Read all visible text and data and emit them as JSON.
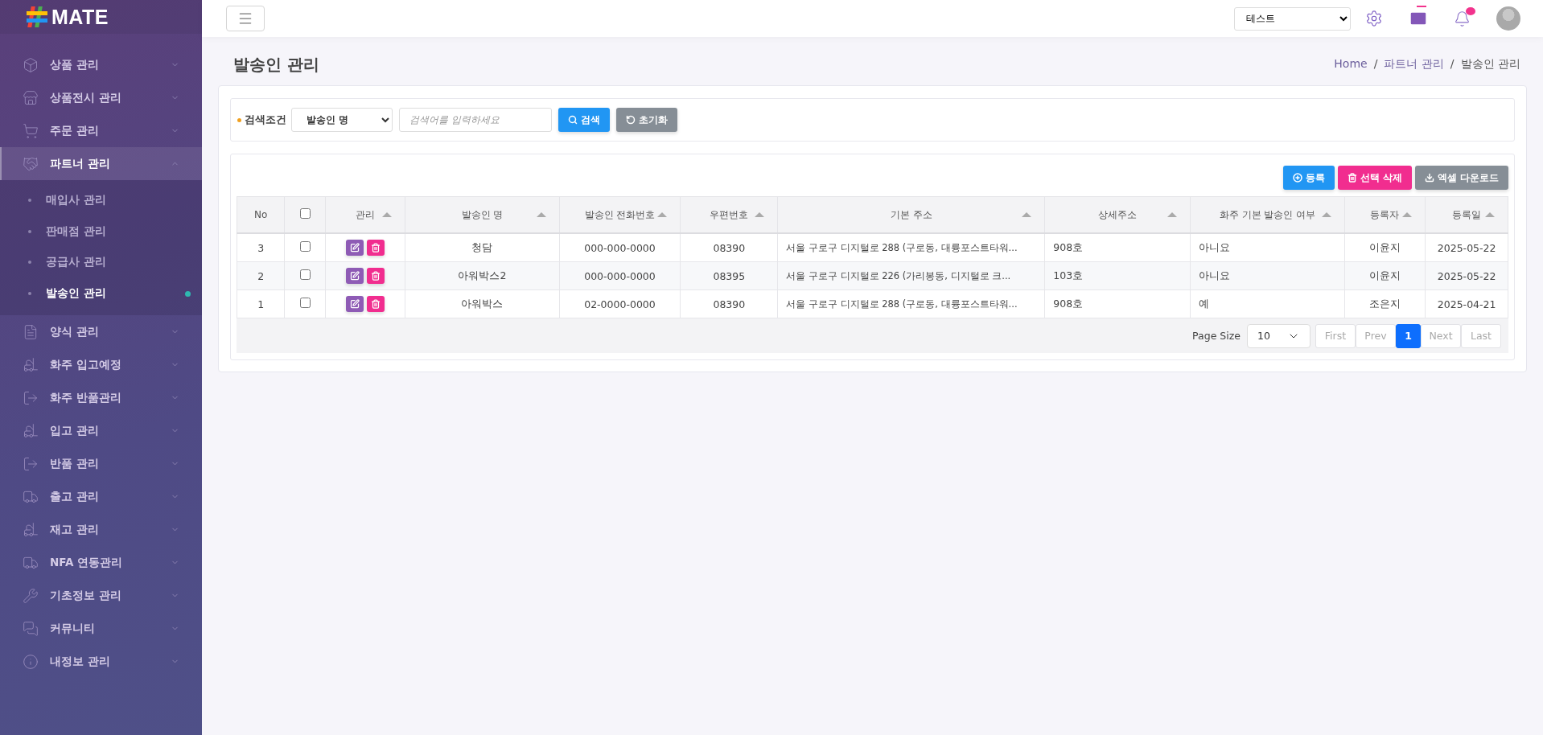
{
  "sidebar": {
    "logo": "MATE",
    "items": [
      {
        "label": "상품 관리",
        "expanded": false,
        "selected": false
      },
      {
        "label": "상품전시 관리",
        "expanded": false,
        "selected": false
      },
      {
        "label": "주문 관리",
        "expanded": false,
        "selected": false
      },
      {
        "label": "파트너 관리",
        "expanded": true,
        "selected": true,
        "children": [
          {
            "label": "매입사 관리",
            "selected": false
          },
          {
            "label": "판매점 관리",
            "selected": false
          },
          {
            "label": "공급사 관리",
            "selected": false
          },
          {
            "label": "발송인 관리",
            "selected": true
          }
        ]
      },
      {
        "label": "양식 관리",
        "expanded": false,
        "selected": false
      },
      {
        "label": "화주 입고예정",
        "expanded": false,
        "selected": false
      },
      {
        "label": "화주 반품관리",
        "expanded": false,
        "selected": false
      },
      {
        "label": "입고 관리",
        "expanded": false,
        "selected": false
      },
      {
        "label": "반품 관리",
        "expanded": false,
        "selected": false
      },
      {
        "label": "출고 관리",
        "expanded": false,
        "selected": false
      },
      {
        "label": "재고 관리",
        "expanded": false,
        "selected": false
      },
      {
        "label": "NFA 연동관리",
        "expanded": false,
        "selected": false
      },
      {
        "label": "기초정보 관리",
        "expanded": false,
        "selected": false
      },
      {
        "label": "커뮤니티",
        "expanded": false,
        "selected": false
      },
      {
        "label": "내정보 관리",
        "expanded": false,
        "selected": false
      }
    ]
  },
  "topbar": {
    "company_select": "테스트"
  },
  "page": {
    "title": "발송인 관리",
    "breadcrumb": {
      "separator": "/",
      "items": [
        {
          "label": "Home",
          "selected": false
        },
        {
          "label": "파트너 관리",
          "selected": false
        },
        {
          "label": "발송인 관리",
          "selected": true
        }
      ]
    }
  },
  "search": {
    "label": "검색조건",
    "field_select": "발송인 명",
    "placeholder": "검색어를 입력하세요",
    "buttons": [
      {
        "label": "검색",
        "kind": "search"
      },
      {
        "label": "초기화",
        "kind": "reset"
      }
    ]
  },
  "actions": [
    {
      "label": "등록",
      "kind": "add"
    },
    {
      "label": "선택 삭제",
      "kind": "delete"
    },
    {
      "label": "엑셀 다운로드",
      "kind": "download"
    }
  ],
  "table": {
    "header_checked": false,
    "columns": [
      {
        "label": "No",
        "sortable": false
      },
      {
        "kind": "check"
      },
      {
        "label": "관리",
        "sortable": true
      },
      {
        "label": "발송인 명",
        "sortable": true
      },
      {
        "label": "발송인 전화번호",
        "sortable": true
      },
      {
        "label": "우편번호",
        "sortable": true
      },
      {
        "label": "기본 주소",
        "sortable": true
      },
      {
        "label": "상세주소",
        "sortable": true
      },
      {
        "label": "화주 기본 발송인 여부",
        "sortable": true
      },
      {
        "label": "등록자",
        "sortable": true
      },
      {
        "label": "등록일",
        "sortable": true
      }
    ],
    "rows": [
      {
        "no": "3",
        "checked": false,
        "name": "청담",
        "phone": "000-000-0000",
        "zip": "08390",
        "address": "서울 구로구 디지털로 288 (구로동, 대륭포스트타워...",
        "detail": "908호",
        "default": "아니요",
        "author": "이윤지",
        "date": "2025-05-22"
      },
      {
        "no": "2",
        "checked": false,
        "name": "아워박스2",
        "phone": "000-000-0000",
        "zip": "08395",
        "address": "서울 구로구 디지털로 226 (가리봉동, 디지털로 크...",
        "detail": "103호",
        "default": "아니요",
        "author": "이윤지",
        "date": "2025-05-22"
      },
      {
        "no": "1",
        "checked": false,
        "name": "아워박스",
        "phone": "02-0000-0000",
        "zip": "08390",
        "address": "서울 구로구 디지털로 288 (구로동, 대륭포스트타워...",
        "detail": "908호",
        "default": "예",
        "author": "조은지",
        "date": "2025-04-21"
      }
    ]
  },
  "pagination": {
    "page_size_label": "Page Size",
    "page_size": "10",
    "buttons": [
      {
        "label": "First",
        "disabled": true,
        "selected": false
      },
      {
        "label": "Prev",
        "disabled": true,
        "selected": false
      },
      {
        "label": "1",
        "disabled": false,
        "selected": true
      },
      {
        "label": "Next",
        "disabled": true,
        "selected": false
      },
      {
        "label": "Last",
        "disabled": true,
        "selected": false
      }
    ]
  }
}
